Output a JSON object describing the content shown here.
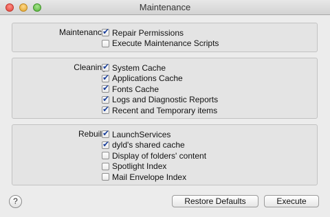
{
  "window": {
    "title": "Maintenance"
  },
  "sections": {
    "maintenance": {
      "label": "Maintenance:",
      "options": [
        {
          "label": "Repair Permissions",
          "checked": true
        },
        {
          "label": "Execute Maintenance Scripts",
          "checked": false
        }
      ]
    },
    "cleaning": {
      "label": "Cleaning:",
      "options": [
        {
          "label": "System Cache",
          "checked": true
        },
        {
          "label": "Applications Cache",
          "checked": true
        },
        {
          "label": "Fonts Cache",
          "checked": true
        },
        {
          "label": "Logs and Diagnostic Reports",
          "checked": true
        },
        {
          "label": "Recent and Temporary items",
          "checked": true
        }
      ]
    },
    "rebuild": {
      "label": "Rebuild:",
      "options": [
        {
          "label": "LaunchServices",
          "checked": true
        },
        {
          "label": "dyld's shared cache",
          "checked": true
        },
        {
          "label": "Display of folders' content",
          "checked": false
        },
        {
          "label": "Spotlight Index",
          "checked": false
        },
        {
          "label": "Mail Envelope Index",
          "checked": false
        }
      ]
    }
  },
  "footer": {
    "help_label": "?",
    "restore_label": "Restore Defaults",
    "execute_label": "Execute"
  }
}
